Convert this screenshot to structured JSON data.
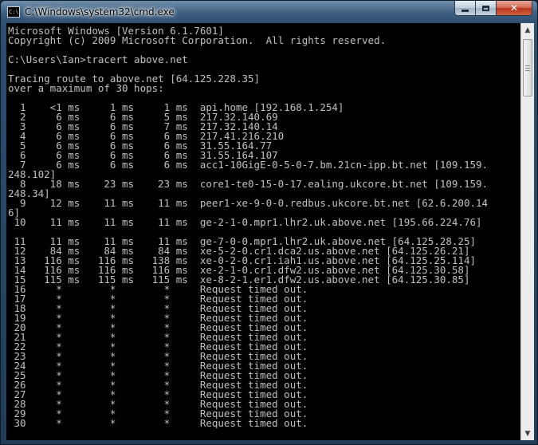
{
  "window": {
    "title": "C:\\Windows\\system32\\cmd.exe",
    "icon_label": "C:\\"
  },
  "console": {
    "lines": [
      "Microsoft Windows [Version 6.1.7601]",
      "Copyright (c) 2009 Microsoft Corporation.  All rights reserved.",
      "",
      "C:\\Users\\Ian>tracert above.net",
      "",
      "Tracing route to above.net [64.125.228.35]",
      "over a maximum of 30 hops:",
      "",
      "  1    <1 ms     1 ms     1 ms  api.home [192.168.1.254]",
      "  2     6 ms     6 ms     5 ms  217.32.140.69",
      "  3     6 ms     6 ms     7 ms  217.32.140.14",
      "  4     6 ms     6 ms     6 ms  217.41.216.210",
      "  5     6 ms     6 ms     6 ms  31.55.164.77",
      "  6     6 ms     6 ms     6 ms  31.55.164.107",
      "  7     6 ms     6 ms     6 ms  acc1-10GigE-0-5-0-7.bm.21cn-ipp.bt.net [109.159.",
      "248.102]",
      "  8    18 ms    23 ms    23 ms  core1-te0-15-0-17.ealing.ukcore.bt.net [109.159.",
      "248.34]",
      "  9    12 ms    11 ms    11 ms  peer1-xe-9-0-0.redbus.ukcore.bt.net [62.6.200.14",
      "6]",
      " 10    11 ms    11 ms    11 ms  ge-2-1-0.mpr1.lhr2.uk.above.net [195.66.224.76]",
      "",
      " 11    11 ms    11 ms    11 ms  ge-7-0-0.mpr1.lhr2.uk.above.net [64.125.28.25]",
      " 12    84 ms    84 ms    84 ms  xe-5-2-0.cr1.dca2.us.above.net [64.125.26.21]",
      " 13   116 ms   116 ms   138 ms  xe-0-2-0.cr1.iah1.us.above.net [64.125.25.114]",
      " 14   116 ms   116 ms   116 ms  xe-2-1-0.cr1.dfw2.us.above.net [64.125.30.58]",
      " 15   115 ms   115 ms   115 ms  xe-8-2-1.er1.dfw2.us.above.net [64.125.30.85]",
      " 16     *        *        *     Request timed out.",
      " 17     *        *        *     Request timed out.",
      " 18     *        *        *     Request timed out.",
      " 19     *        *        *     Request timed out.",
      " 20     *        *        *     Request timed out.",
      " 21     *        *        *     Request timed out.",
      " 22     *        *        *     Request timed out.",
      " 23     *        *        *     Request timed out.",
      " 24     *        *        *     Request timed out.",
      " 25     *        *        *     Request timed out.",
      " 26     *        *        *     Request timed out.",
      " 27     *        *        *     Request timed out.",
      " 28     *        *        *     Request timed out.",
      " 29     *        *        *     Request timed out.",
      " 30     *        *        *     Request timed out."
    ]
  },
  "icons": {
    "app": "cmd-icon",
    "minimize": "minimize-icon",
    "maximize": "maximize-icon",
    "close": "close-icon",
    "scroll_up": "chevron-up-icon",
    "scroll_down": "chevron-down-icon"
  },
  "colors": {
    "console_bg": "#000000",
    "console_text": "#c0c0c0",
    "close_button": "#c7462c"
  }
}
